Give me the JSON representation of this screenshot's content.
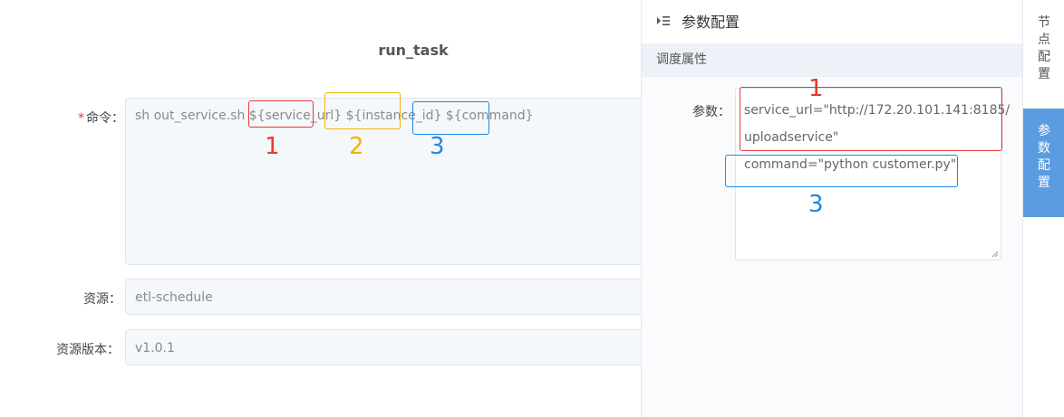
{
  "form": {
    "title": "run_task",
    "command_label": "命令：",
    "command_required_mark": "*",
    "command_prefix": "sh out_service.sh $",
    "command_p1": "{service_url",
    "command_p1_end": "}",
    "command_p2": "${instance_id}",
    "command_p3": "${command}",
    "resource_label": "资源：",
    "resource_value": "etl-schedule",
    "version_label": "资源版本：",
    "version_value": "v1.0.1"
  },
  "annotations": {
    "one": "1",
    "two": "2",
    "three": "3",
    "colors": {
      "red": "#e53935",
      "yellow": "#f0b400",
      "blue": "#1e88e5"
    }
  },
  "panel": {
    "title": "参数配置",
    "section": "调度属性",
    "param_label": "参数：",
    "param_lines": [
      "service_url=\"http://172.20.101.141:8185/",
      "uploadservice\"",
      "command=\"python customer.py\""
    ]
  },
  "tabs": {
    "node_config": [
      "节",
      "点",
      "配",
      "置"
    ],
    "param_config": [
      "参",
      "数",
      "配",
      "置"
    ],
    "active_color": "#5b9be1"
  }
}
